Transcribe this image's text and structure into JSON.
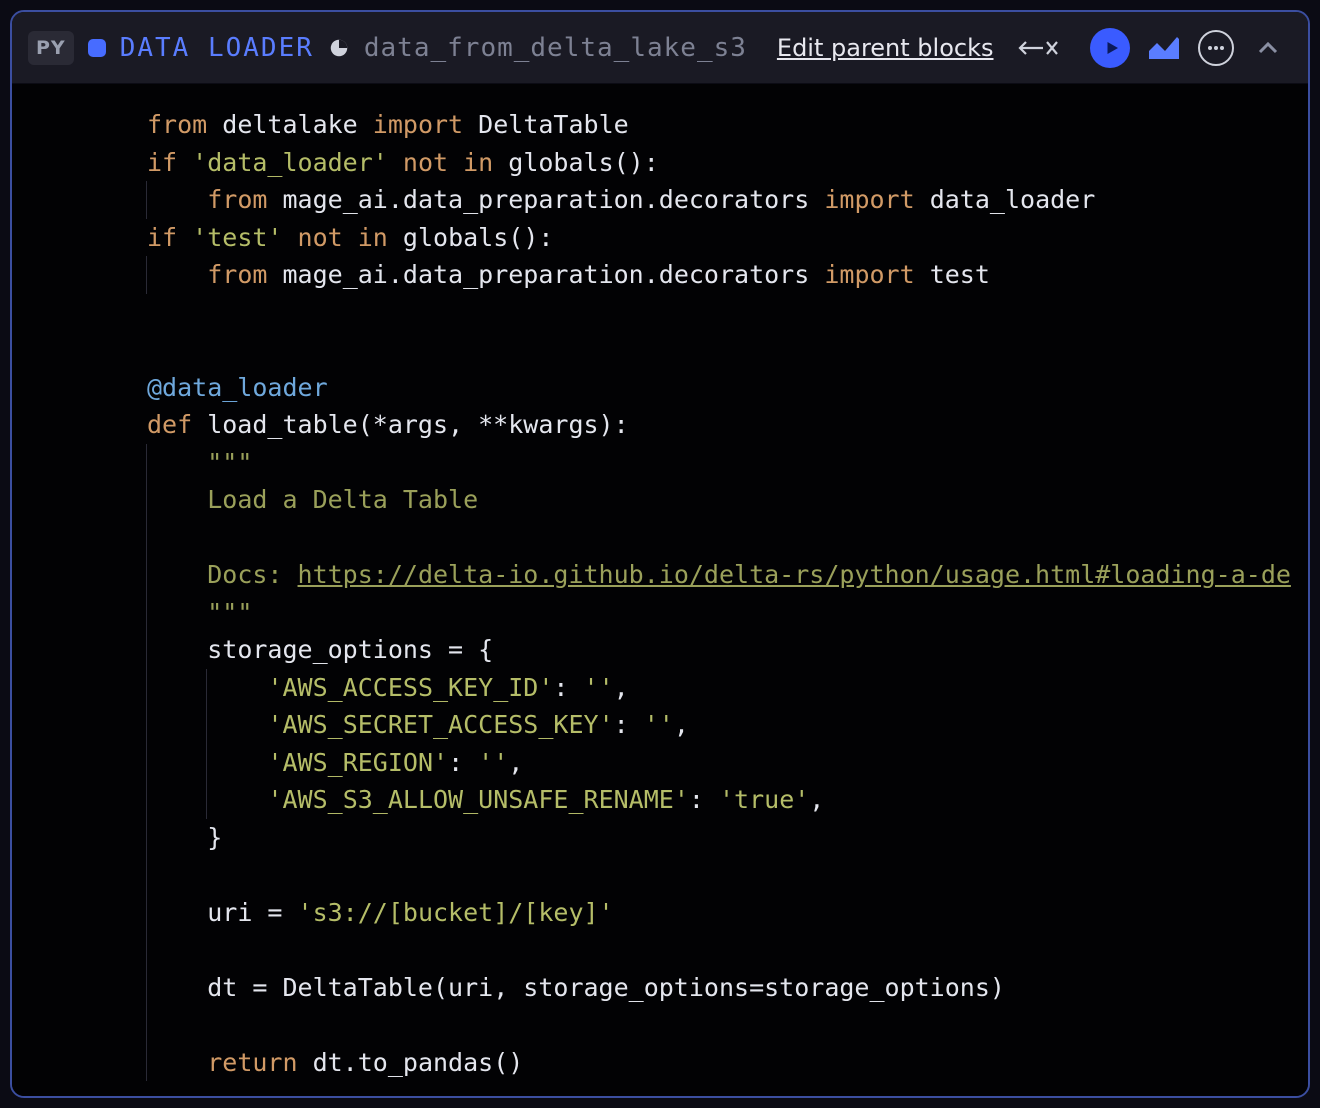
{
  "toolbar": {
    "lang_badge": "PY",
    "block_type_label": "DATA LOADER",
    "block_name": "data_from_delta_lake_s3",
    "edit_parent_label": "Edit parent blocks",
    "accent_color": "#476cff"
  },
  "icons": {
    "pie": "pie-chart-icon",
    "run": "play-icon",
    "chart": "chart-icon",
    "more": "more-icon",
    "collapse": "chevron-up-icon",
    "disconnect": "disconnect-icon"
  },
  "code": {
    "lines": [
      {
        "t": [
          [
            "kw",
            "from"
          ],
          [
            "op",
            " deltalake "
          ],
          [
            "kw",
            "import"
          ],
          [
            "op",
            " DeltaTable"
          ]
        ]
      },
      {
        "t": [
          [
            "kw",
            "if"
          ],
          [
            "op",
            " "
          ],
          [
            "str",
            "'data_loader'"
          ],
          [
            "op",
            " "
          ],
          [
            "kw",
            "not in"
          ],
          [
            "op",
            " globals():"
          ]
        ]
      },
      {
        "indent": 1,
        "t": [
          [
            "kw",
            "from"
          ],
          [
            "op",
            " mage_ai.data_preparation.decorators "
          ],
          [
            "kw",
            "import"
          ],
          [
            "op",
            " data_loader"
          ]
        ]
      },
      {
        "t": [
          [
            "kw",
            "if"
          ],
          [
            "op",
            " "
          ],
          [
            "str",
            "'test'"
          ],
          [
            "op",
            " "
          ],
          [
            "kw",
            "not in"
          ],
          [
            "op",
            " globals():"
          ]
        ]
      },
      {
        "indent": 1,
        "t": [
          [
            "kw",
            "from"
          ],
          [
            "op",
            " mage_ai.data_preparation.decorators "
          ],
          [
            "kw",
            "import"
          ],
          [
            "op",
            " test"
          ]
        ]
      },
      {
        "blank": true
      },
      {
        "blank": true
      },
      {
        "t": [
          [
            "dec",
            "@data_loader"
          ]
        ]
      },
      {
        "t": [
          [
            "kw",
            "def"
          ],
          [
            "op",
            " load_table(*args, **kwargs):"
          ]
        ]
      },
      {
        "indent": 1,
        "t": [
          [
            "doc",
            "\"\"\""
          ]
        ]
      },
      {
        "indent": 1,
        "t": [
          [
            "doc",
            "Load a Delta Table"
          ]
        ]
      },
      {
        "blank": true,
        "indent": 1
      },
      {
        "indent": 1,
        "t": [
          [
            "doc",
            "Docs: "
          ],
          [
            "url",
            "https://delta-io.github.io/delta-rs/python/usage.html#loading-a-de"
          ]
        ]
      },
      {
        "indent": 1,
        "t": [
          [
            "doc",
            "\"\"\""
          ]
        ]
      },
      {
        "indent": 1,
        "t": [
          [
            "op",
            "storage_options = {"
          ]
        ]
      },
      {
        "indent": 2,
        "t": [
          [
            "str",
            "'AWS_ACCESS_KEY_ID'"
          ],
          [
            "op",
            ": "
          ],
          [
            "str",
            "''"
          ],
          [
            "op",
            ","
          ]
        ]
      },
      {
        "indent": 2,
        "t": [
          [
            "str",
            "'AWS_SECRET_ACCESS_KEY'"
          ],
          [
            "op",
            ": "
          ],
          [
            "str",
            "''"
          ],
          [
            "op",
            ","
          ]
        ]
      },
      {
        "indent": 2,
        "t": [
          [
            "str",
            "'AWS_REGION'"
          ],
          [
            "op",
            ": "
          ],
          [
            "str",
            "''"
          ],
          [
            "op",
            ","
          ]
        ]
      },
      {
        "indent": 2,
        "t": [
          [
            "str",
            "'AWS_S3_ALLOW_UNSAFE_RENAME'"
          ],
          [
            "op",
            ": "
          ],
          [
            "str",
            "'true'"
          ],
          [
            "op",
            ","
          ]
        ]
      },
      {
        "indent": 1,
        "t": [
          [
            "op",
            "}"
          ]
        ]
      },
      {
        "blank": true,
        "indent": 1
      },
      {
        "indent": 1,
        "t": [
          [
            "op",
            "uri = "
          ],
          [
            "str",
            "'s3://[bucket]/[key]'"
          ]
        ]
      },
      {
        "blank": true,
        "indent": 1
      },
      {
        "indent": 1,
        "t": [
          [
            "op",
            "dt = DeltaTable(uri, storage_options=storage_options)"
          ]
        ]
      },
      {
        "blank": true,
        "indent": 1
      },
      {
        "indent": 1,
        "t": [
          [
            "kw",
            "return"
          ],
          [
            "op",
            " dt.to_pandas()"
          ]
        ]
      }
    ]
  }
}
